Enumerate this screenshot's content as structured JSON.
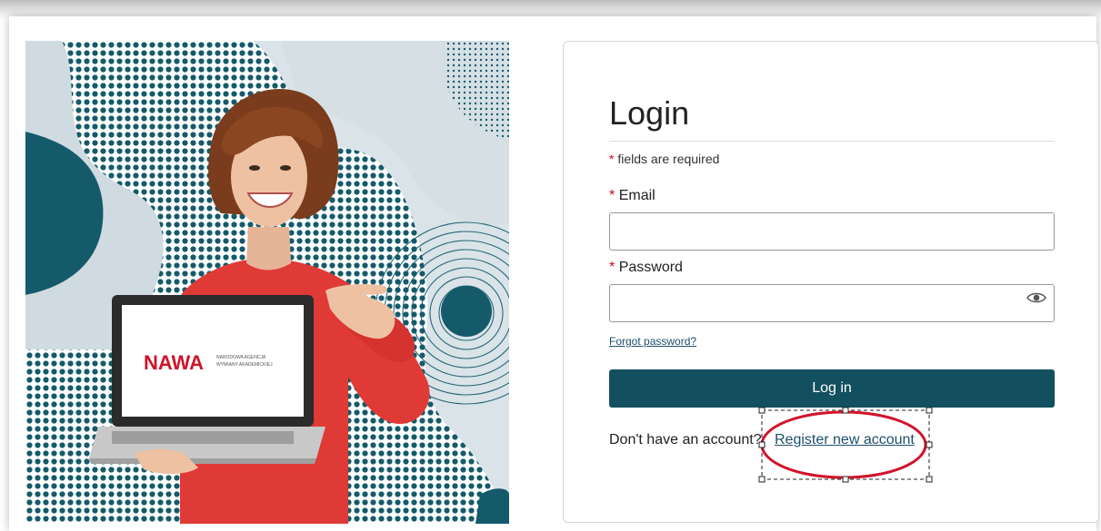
{
  "hero": {
    "laptop_logo_text": "NAWA",
    "laptop_logo_sub1": "NARODOWA AGENCJA",
    "laptop_logo_sub2": "WYMIANY AKADEMICKIEJ"
  },
  "login": {
    "title": "Login",
    "required_star": "*",
    "required_note": "fields are required",
    "email_label": "Email",
    "email_value": "",
    "password_label": "Password",
    "password_value": "",
    "forgot_password": "Forgot password?",
    "login_button": "Log in",
    "no_account_text": "Don't have an account?",
    "register_link": "Register new account"
  },
  "colors": {
    "primary": "#12505f",
    "link": "#1f4f6e",
    "required": "#d0021b",
    "annotation": "#d0142a",
    "sweater": "#e03a36"
  }
}
